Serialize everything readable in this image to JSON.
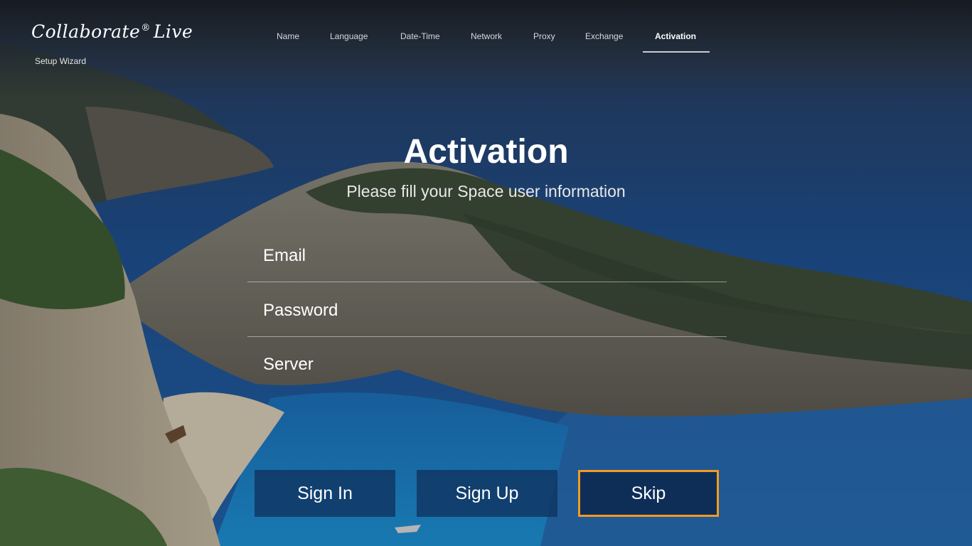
{
  "brand": {
    "logo": "Collaborate",
    "logo_mark": "®",
    "logo_suffix": "Live",
    "subtitle": "Setup Wizard"
  },
  "nav": {
    "tabs": [
      {
        "label": "Name"
      },
      {
        "label": "Language"
      },
      {
        "label": "Date-Time"
      },
      {
        "label": "Network"
      },
      {
        "label": "Proxy"
      },
      {
        "label": "Exchange"
      },
      {
        "label": "Activation",
        "active": true
      }
    ]
  },
  "page": {
    "title": "Activation",
    "subtitle": "Please fill your Space user information"
  },
  "form": {
    "email_label": "Email",
    "password_label": "Password",
    "server_label": "Server"
  },
  "buttons": {
    "sign_in": "Sign In",
    "sign_up": "Sign Up",
    "skip": "Skip"
  },
  "colors": {
    "focus_outline": "#f29a22",
    "button_bg": "#103562"
  },
  "icons": {
    "background": "coastal-cove-photo"
  }
}
